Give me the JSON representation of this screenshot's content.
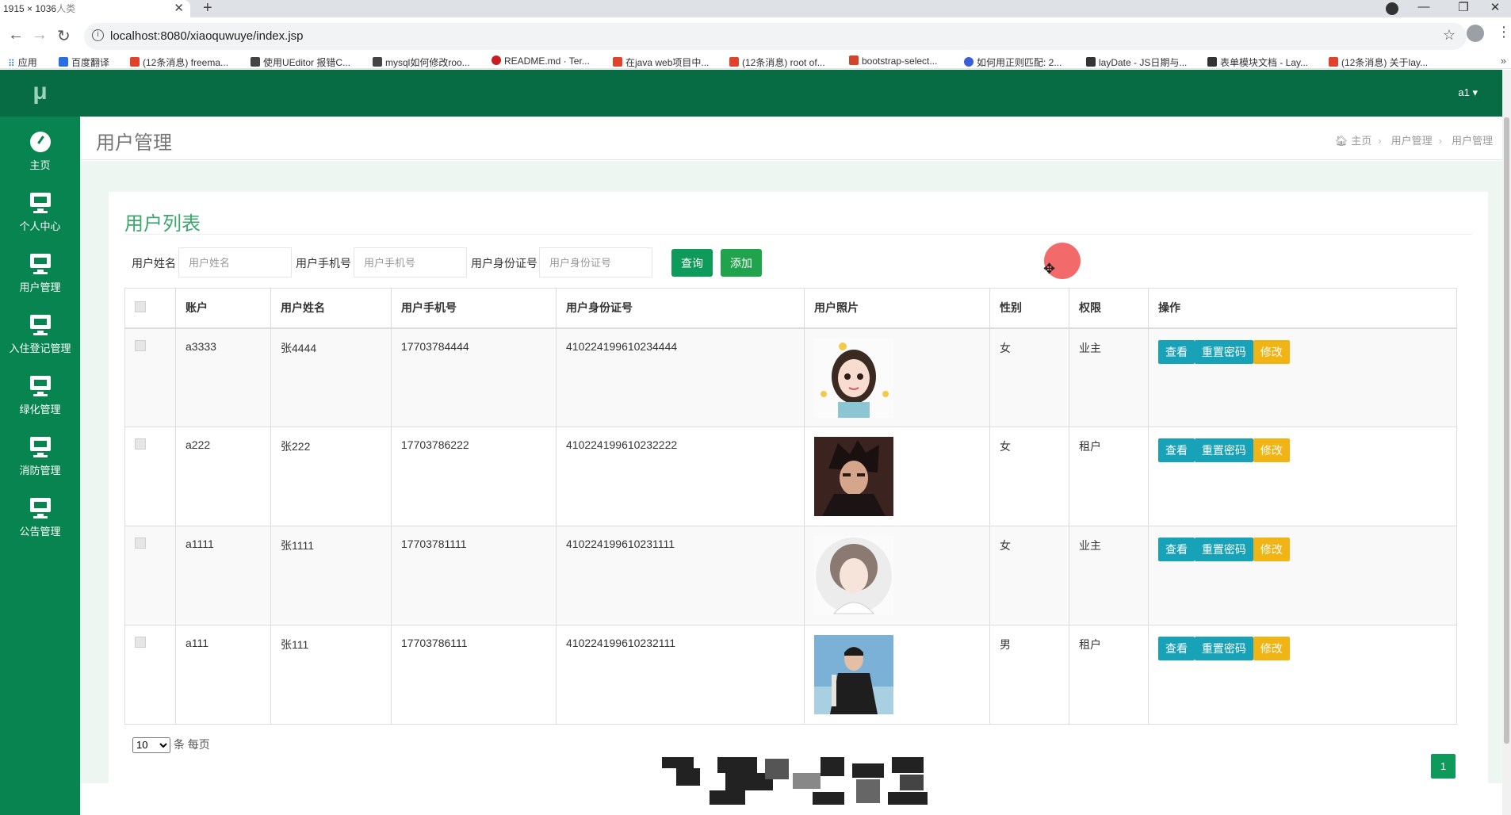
{
  "browser": {
    "tab_title": "1915 × 1036",
    "tab_title_rest": "人类",
    "url": "localhost:8080/xiaoquwuye/index.jsp",
    "bookmarks": [
      {
        "label": "应用",
        "color": "#1a73e8"
      },
      {
        "label": "百度翻译",
        "color": "#2b6de5"
      },
      {
        "label": "(12条消息) freema...",
        "color": "#e0422c"
      },
      {
        "label": "使用UEditor 报错C...",
        "color": "#444444"
      },
      {
        "label": "mysql如何修改roo...",
        "color": "#444444"
      },
      {
        "label": "README.md · Ter...",
        "color": "#c71d23"
      },
      {
        "label": "在java web项目中...",
        "color": "#e0422c"
      },
      {
        "label": "(12条消息) root of...",
        "color": "#e0422c"
      },
      {
        "label": "bootstrap-select...",
        "color": "#d2452c"
      },
      {
        "label": "如何用正则匹配: 2...",
        "color": "#3a5dd9"
      },
      {
        "label": "layDate - JS日期与...",
        "color": "#333333"
      },
      {
        "label": "表单模块文档 - Lay...",
        "color": "#333333"
      },
      {
        "label": "(12条消息) 关于lay...",
        "color": "#e0422c"
      }
    ]
  },
  "app": {
    "logo": "μ",
    "user": "a1",
    "sidebar": [
      {
        "label": "主页",
        "icon": "dashboard-icon"
      },
      {
        "label": "个人中心",
        "icon": "monitor-icon"
      },
      {
        "label": "用户管理",
        "icon": "monitor-icon"
      },
      {
        "label": "入住登记管理",
        "icon": "monitor-icon"
      },
      {
        "label": "绿化管理",
        "icon": "monitor-icon"
      },
      {
        "label": "消防管理",
        "icon": "monitor-icon"
      },
      {
        "label": "公告管理",
        "icon": "monitor-icon"
      }
    ],
    "page_title": "用户管理",
    "breadcrumb": [
      "主页",
      "用户管理",
      "用户管理"
    ]
  },
  "panel": {
    "title": "用户列表",
    "search": {
      "name_label": "用户姓名",
      "name_placeholder": "用户姓名",
      "phone_label": "用户手机号",
      "phone_placeholder": "用户手机号",
      "id_label": "用户身份证号",
      "id_placeholder": "用户身份证号",
      "query": "查询",
      "add": "添加"
    },
    "columns": [
      "账户",
      "用户姓名",
      "用户手机号",
      "用户身份证号",
      "用户照片",
      "性别",
      "权限",
      "操作"
    ],
    "rows": [
      {
        "account": "a3333",
        "name": "张4444",
        "phone": "17703784444",
        "idcard": "410224199610234444",
        "gender": "女",
        "role": "业主"
      },
      {
        "account": "a222",
        "name": "张222",
        "phone": "17703786222",
        "idcard": "410224199610232222",
        "gender": "女",
        "role": "租户"
      },
      {
        "account": "a1111",
        "name": "张1111",
        "phone": "17703781111",
        "idcard": "410224199610231111",
        "gender": "女",
        "role": "业主"
      },
      {
        "account": "a111",
        "name": "张111",
        "phone": "17703786111",
        "idcard": "410224199610232111",
        "gender": "男",
        "role": "租户"
      }
    ],
    "actions": {
      "view": "查看",
      "reset": "重置密码",
      "edit": "修改"
    },
    "page_size": "10",
    "page_size_suffix": "条 每页",
    "current_page": "1"
  }
}
